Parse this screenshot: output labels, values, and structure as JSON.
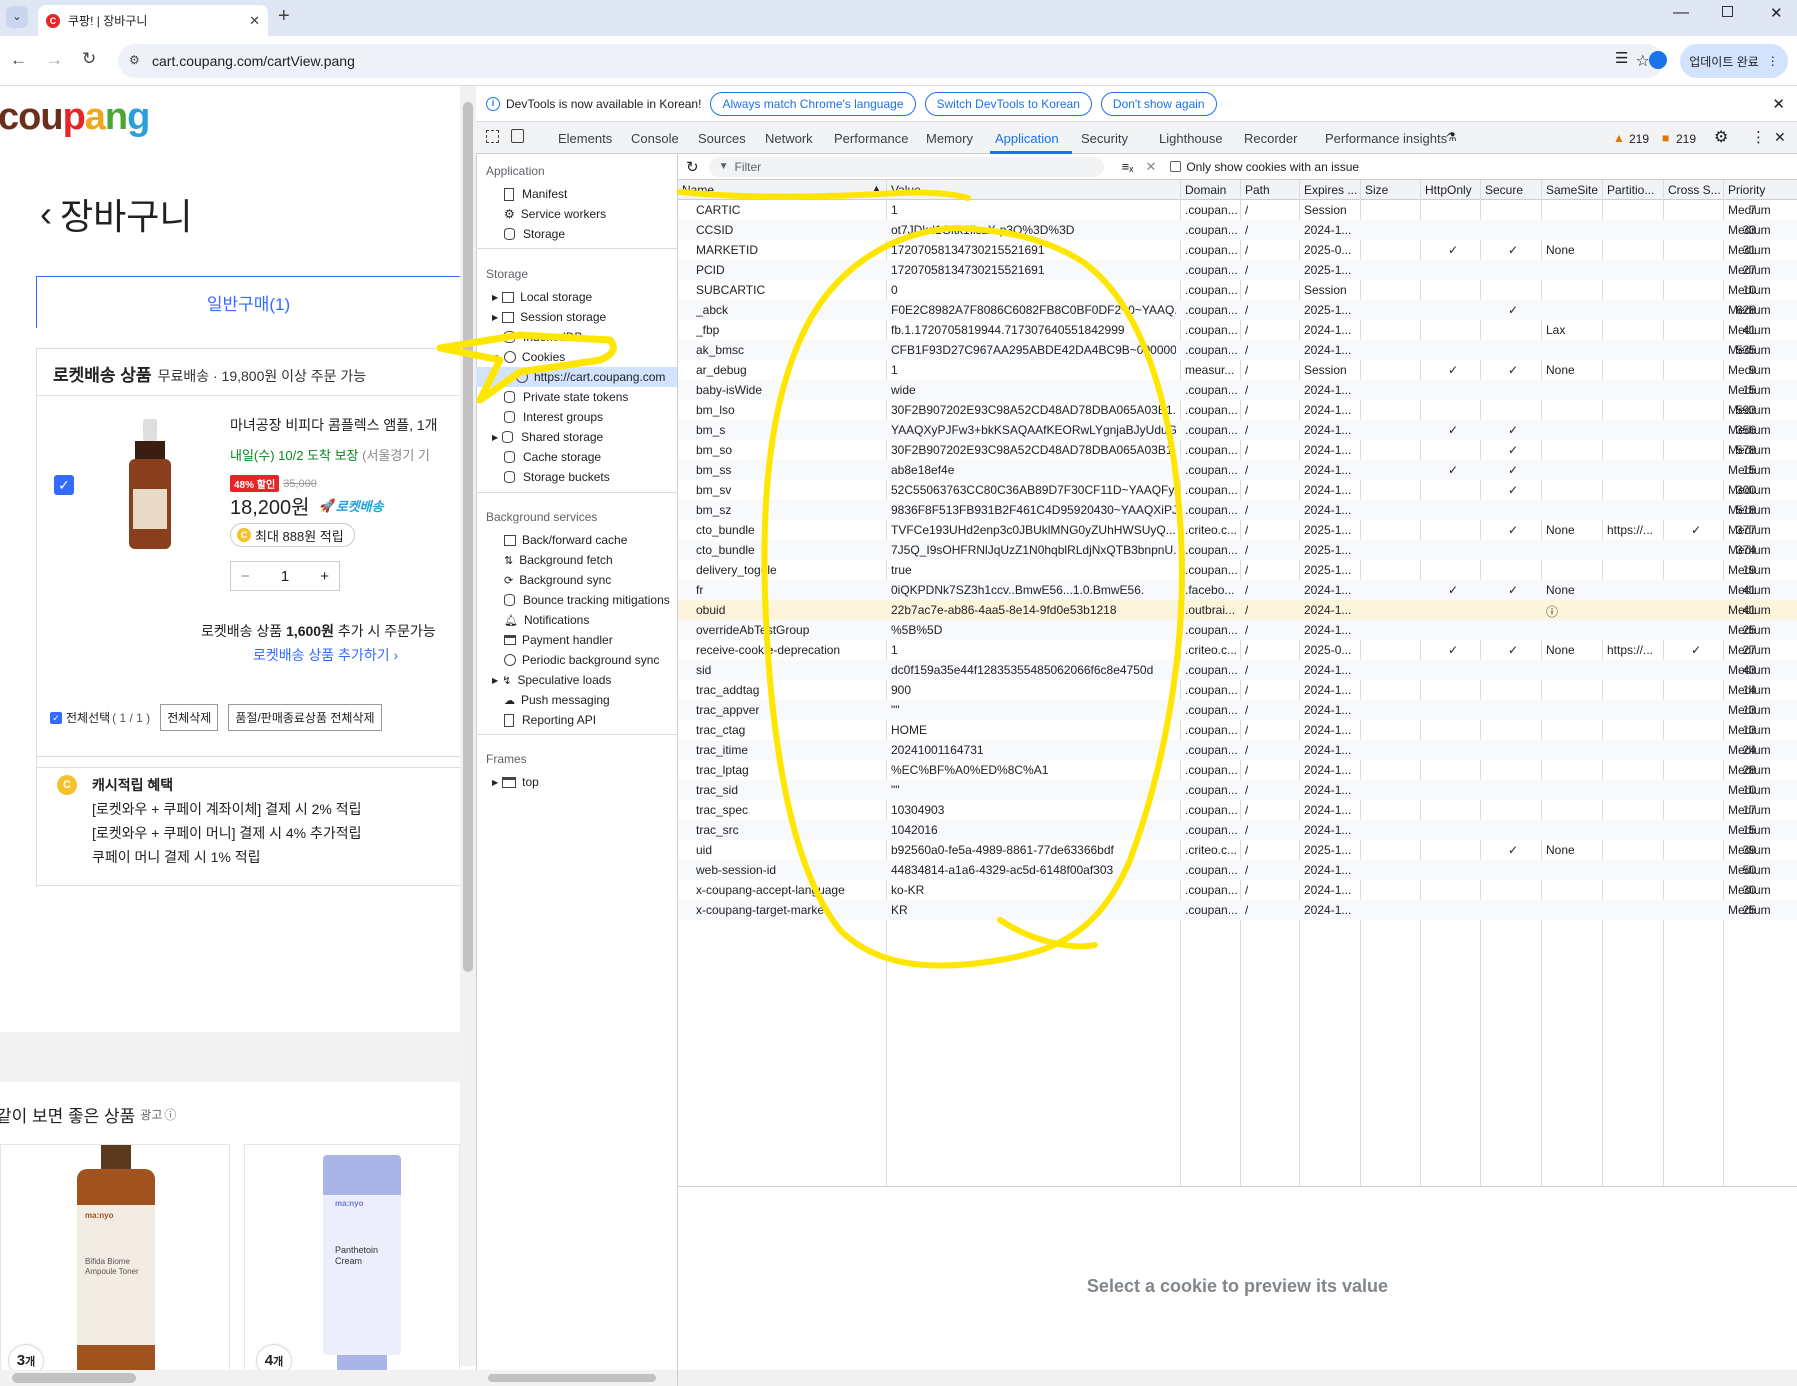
{
  "browser": {
    "tab_title": "쿠팡! | 장바구니",
    "url": "cart.coupang.com/cartView.pang",
    "update_label": "업데이트 완료"
  },
  "page": {
    "logo": "coupang",
    "heading": "장바구니",
    "cart_tab": "일반구매(1)",
    "rocket_section": "로켓배송 상품",
    "free_ship": "무료배송 · 19,800원 이상 주문 가능",
    "product_name": "마녀공장 비피다 콤플렉스 앰플, 1개",
    "delivery": "내일(수) 10/2 도착 보장",
    "delivery_region": "(서울경기 기",
    "discount_badge": "48% 할인",
    "old_price": "35,000",
    "price": "18,200원",
    "rocket_badge": "로켓배송",
    "reward": "최대 888원 적립",
    "qty": "1",
    "more_pre": "로켓배송 상품",
    "more_amount": "1,600원",
    "more_post": "추가 시 주문가능",
    "add_more": "로켓배송 상품 추가하기 ›",
    "select_all": "전체선택",
    "select_count": "( 1 / 1 )",
    "delete_all": "전체삭제",
    "delete_soldout": "품절/판매종료상품 전체삭제",
    "cash_title": "캐시적립 혜택",
    "cash_lines": [
      "[로켓와우 + 쿠페이 계좌이체] 결제 시 2% 적립",
      "[로켓와우 + 쿠페이 머니] 결제 시 4% 추가적립",
      "쿠페이 머니 결제 시 1% 적립"
    ],
    "recommend_title": "같이 보면 좋은 상품",
    "ad_label": "광고",
    "rec_items": [
      {
        "brand": "ma:nyo",
        "name": "Bifida Biome Ampoule Toner",
        "count_num": "3",
        "count_unit": "개"
      },
      {
        "brand": "ma:nyo",
        "name": "Panthetoin Cream",
        "count_num": "4",
        "count_unit": "개"
      }
    ]
  },
  "devtools": {
    "info": "DevTools is now available in Korean!",
    "info_buttons": [
      "Always match Chrome's language",
      "Switch DevTools to Korean",
      "Don't show again"
    ],
    "tabs": [
      "Elements",
      "Console",
      "Sources",
      "Network",
      "Performance",
      "Memory",
      "Application",
      "Security",
      "Lighthouse",
      "Recorder",
      "Performance insights"
    ],
    "active_tab": "Application",
    "warn_count": "219",
    "issue_count": "219",
    "sidebar": {
      "application_header": "Application",
      "application_items": [
        "Manifest",
        "Service workers",
        "Storage"
      ],
      "storage_header": "Storage",
      "storage_items": [
        "Local storage",
        "Session storage",
        "IndexedDB",
        "Cookies"
      ],
      "cookie_origin": "https://cart.coupang.com",
      "storage_items2": [
        "Private state tokens",
        "Interest groups",
        "Shared storage",
        "Cache storage",
        "Storage buckets"
      ],
      "bg_header": "Background services",
      "bg_items": [
        "Back/forward cache",
        "Background fetch",
        "Background sync",
        "Bounce tracking mitigations",
        "Notifications",
        "Payment handler",
        "Periodic background sync",
        "Speculative loads",
        "Push messaging",
        "Reporting API"
      ],
      "frames_header": "Frames",
      "frames_items": [
        "top"
      ]
    },
    "filter_placeholder": "Filter",
    "only_issues": "Only show cookies with an issue",
    "columns": [
      "Name",
      "Value",
      "Domain",
      "Path",
      "Expires ...",
      "Size",
      "HttpOnly",
      "Secure",
      "SameSite",
      "Partitio...",
      "Cross S...",
      "Priority"
    ],
    "preview_text": "Select a cookie to preview its value"
  },
  "cookies": [
    [
      "CARTIC",
      "1",
      ".coupan...",
      "/",
      "Session",
      "7",
      "",
      "",
      "",
      "",
      "",
      "Medium"
    ],
    [
      "CCSID",
      "ot7JDkd1Gltk1IiszX-p3Q%3D%3D",
      ".coupan...",
      "/",
      "2024-1...",
      "33",
      "",
      "",
      "",
      "",
      "",
      "Medium"
    ],
    [
      "MARKETID",
      "17207058134730215521691",
      ".coupan...",
      "/",
      "2025-0...",
      "31",
      "✓",
      "✓",
      "None",
      "",
      "",
      "Medium"
    ],
    [
      "PCID",
      "17207058134730215521691",
      ".coupan...",
      "/",
      "2025-1...",
      "27",
      "",
      "",
      "",
      "",
      "",
      "Medium"
    ],
    [
      "SUBCARTIC",
      "0",
      ".coupan...",
      "/",
      "Session",
      "10",
      "",
      "",
      "",
      "",
      "",
      "Medium"
    ],
    [
      "_abck",
      "F0E2C8982A7F8086C6082FB8C0BF0DF2~0~YAAQ...",
      ".coupan...",
      "/",
      "2025-1...",
      "628",
      "",
      "✓",
      "",
      "",
      "",
      "Medium"
    ],
    [
      "_fbp",
      "fb.1.1720705819944.717307640551842999",
      ".coupan...",
      "/",
      "2024-1...",
      "41",
      "",
      "",
      "Lax",
      "",
      "",
      "Medium"
    ],
    [
      "ak_bmsc",
      "CFB1F93D27C967AA295ABDE42DA4BC9B~000000...",
      ".coupan...",
      "/",
      "2024-1...",
      "535",
      "",
      "",
      "",
      "",
      "",
      "Medium"
    ],
    [
      "ar_debug",
      "1",
      "measur...",
      "/",
      "Session",
      "9",
      "✓",
      "✓",
      "None",
      "",
      "",
      "Medium"
    ],
    [
      "baby-isWide",
      "wide",
      ".coupan...",
      "/",
      "2024-1...",
      "15",
      "",
      "",
      "",
      "",
      "",
      "Medium"
    ],
    [
      "bm_lso",
      "30F2B907202E93C98A52CD48AD78DBA065A03B1...",
      ".coupan...",
      "/",
      "2024-1...",
      "593",
      "",
      "",
      "",
      "",
      "",
      "Medium"
    ],
    [
      "bm_s",
      "YAAQXyPJFw3+bkKSAQAAfKEORwLYgnjaBJyUduG...",
      ".coupan...",
      "/",
      "2024-1...",
      "356",
      "✓",
      "✓",
      "",
      "",
      "",
      "Medium"
    ],
    [
      "bm_so",
      "30F2B907202E93C98A52CD48AD78DBA065A03B1...",
      ".coupan...",
      "/",
      "2024-1...",
      "578",
      "",
      "✓",
      "",
      "",
      "",
      "Medium"
    ],
    [
      "bm_ss",
      "ab8e18ef4e",
      ".coupan...",
      "/",
      "2024-1...",
      "15",
      "✓",
      "✓",
      "",
      "",
      "",
      "Medium"
    ],
    [
      "bm_sv",
      "52C55063763CC80C36AB89D7F30CF11D~YAAQFy...",
      ".coupan...",
      "/",
      "2024-1...",
      "300",
      "",
      "✓",
      "",
      "",
      "",
      "Medium"
    ],
    [
      "bm_sz",
      "9836F8F513FB931B2F461C4D95920430~YAAQXiPJ...",
      ".coupan...",
      "/",
      "2024-1...",
      "518",
      "",
      "",
      "",
      "",
      "",
      "Medium"
    ],
    [
      "cto_bundle",
      "TVFCe193UHd2enp3c0JBUklMNG0yZUhHWSUyQ...",
      ".criteo.c...",
      "/",
      "2025-1...",
      "377",
      "",
      "✓",
      "None",
      "https://...",
      "✓",
      "Medium"
    ],
    [
      "cto_bundle",
      "7J5Q_I9sOHFRNlJqUzZ1N0hqblRLdjNxQTB3bnpnU...",
      ".coupan...",
      "/",
      "2025-1...",
      "374",
      "",
      "",
      "",
      "",
      "",
      "Medium"
    ],
    [
      "delivery_toggle",
      "true",
      ".coupan...",
      "/",
      "2025-1...",
      "19",
      "",
      "",
      "",
      "",
      "",
      "Medium"
    ],
    [
      "fr",
      "0iQKPDNk7SZ3h1ccv..BmwE56...1.0.BmwE56.",
      ".facebo...",
      "/",
      "2024-1...",
      "41",
      "✓",
      "✓",
      "None",
      "",
      "",
      "Medium"
    ],
    [
      "obuid",
      "22b7ac7e-ab86-4aa5-8e14-9fd0e53b1218",
      ".outbrai...",
      "/",
      "2024-1...",
      "41",
      "",
      "",
      "ⓘ",
      "",
      "",
      "Medium"
    ],
    [
      "overrideAbTestGroup",
      "%5B%5D",
      ".coupan...",
      "/",
      "2024-1...",
      "25",
      "",
      "",
      "",
      "",
      "",
      "Medium"
    ],
    [
      "receive-cookie-deprecation",
      "1",
      ".criteo.c...",
      "/",
      "2025-0...",
      "27",
      "✓",
      "✓",
      "None",
      "https://...",
      "✓",
      "Medium"
    ],
    [
      "sid",
      "dc0f159a35e44f12835355485062066f6c8e4750d",
      ".coupan...",
      "/",
      "2024-1...",
      "43",
      "",
      "",
      "",
      "",
      "",
      "Medium"
    ],
    [
      "trac_addtag",
      "900",
      ".coupan...",
      "/",
      "2024-1...",
      "14",
      "",
      "",
      "",
      "",
      "",
      "Medium"
    ],
    [
      "trac_appver",
      "\"\"",
      ".coupan...",
      "/",
      "2024-1...",
      "13",
      "",
      "",
      "",
      "",
      "",
      "Medium"
    ],
    [
      "trac_ctag",
      "HOME",
      ".coupan...",
      "/",
      "2024-1...",
      "13",
      "",
      "",
      "",
      "",
      "",
      "Medium"
    ],
    [
      "trac_itime",
      "20241001164731",
      ".coupan...",
      "/",
      "2024-1...",
      "24",
      "",
      "",
      "",
      "",
      "",
      "Medium"
    ],
    [
      "trac_lptag",
      "%EC%BF%A0%ED%8C%A1",
      ".coupan...",
      "/",
      "2024-1...",
      "28",
      "",
      "",
      "",
      "",
      "",
      "Medium"
    ],
    [
      "trac_sid",
      "\"\"",
      ".coupan...",
      "/",
      "2024-1...",
      "10",
      "",
      "",
      "",
      "",
      "",
      "Medium"
    ],
    [
      "trac_spec",
      "10304903",
      ".coupan...",
      "/",
      "2024-1...",
      "17",
      "",
      "",
      "",
      "",
      "",
      "Medium"
    ],
    [
      "trac_src",
      "1042016",
      ".coupan...",
      "/",
      "2024-1...",
      "15",
      "",
      "",
      "",
      "",
      "",
      "Medium"
    ],
    [
      "uid",
      "b92560a0-fe5a-4989-8861-77de63366bdf",
      ".criteo.c...",
      "/",
      "2025-1...",
      "39",
      "",
      "✓",
      "None",
      "",
      "",
      "Medium"
    ],
    [
      "web-session-id",
      "44834814-a1a6-4329-ac5d-6148f00af303",
      ".coupan...",
      "/",
      "2024-1...",
      "50",
      "",
      "",
      "",
      "",
      "",
      "Medium"
    ],
    [
      "x-coupang-accept-language",
      "ko-KR",
      ".coupan...",
      "/",
      "2024-1...",
      "30",
      "",
      "",
      "",
      "",
      "",
      "Medium"
    ],
    [
      "x-coupang-target-market",
      "KR",
      ".coupan...",
      "/",
      "2024-1...",
      "25",
      "",
      "",
      "",
      "",
      "",
      "Medium"
    ]
  ],
  "selected_cookie_index": 20,
  "colors": {
    "accent": "#1a73e8",
    "coupang_blue": "#346aff",
    "annotation": "#ffe600"
  }
}
